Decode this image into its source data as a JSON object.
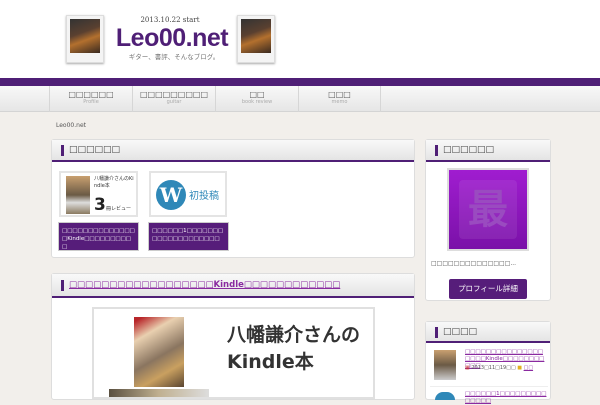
{
  "site": {
    "date": "2013.10.22 start",
    "logo": "Leo00.net",
    "tagline": "ギター、書評、そんなブログ。"
  },
  "nav": [
    {
      "label": "□□□□□□",
      "sub": "Profile"
    },
    {
      "label": "□□□□□□□□□",
      "sub": "guitar"
    },
    {
      "label": "□□",
      "sub": "book review"
    },
    {
      "label": "□□□",
      "sub": "memo"
    }
  ],
  "breadcrumb": "Leo00.net",
  "featured": {
    "title": "□□□□□□",
    "items": [
      {
        "thumb_title": "八幡謙介さんのKindle本",
        "thumb_num": "3",
        "thumb_suffix": "冊レビュー",
        "caption": "□□□□□□□□□□□□□□□Kindle□□□□□□□□□□"
      },
      {
        "thumb_title": "初投稿",
        "caption": "□□□□□□1□□□□□□□□□□□□□□□□□□□□"
      }
    ]
  },
  "post": {
    "title": "□□□□□□□□□□□□□□□□□□Kindle□□□□□□□□□□□□",
    "image_text1": "八幡謙介さんの",
    "image_text2": "Kindle本"
  },
  "profile": {
    "title": "□□□□□□",
    "icon_char": "最",
    "text": "□□□□□□□□□□□□□□...",
    "button": "プロフィール詳細"
  },
  "recent": {
    "title": "□□□□",
    "items": [
      {
        "title": "□□□□□□□□□□□□□□□□□□□Kindle□□□□□□□□□□□",
        "date": "2013□11□19□□",
        "category": "□□"
      },
      {
        "title": "□□□□□□1□□□□□□□□□□□□□□"
      }
    ]
  }
}
